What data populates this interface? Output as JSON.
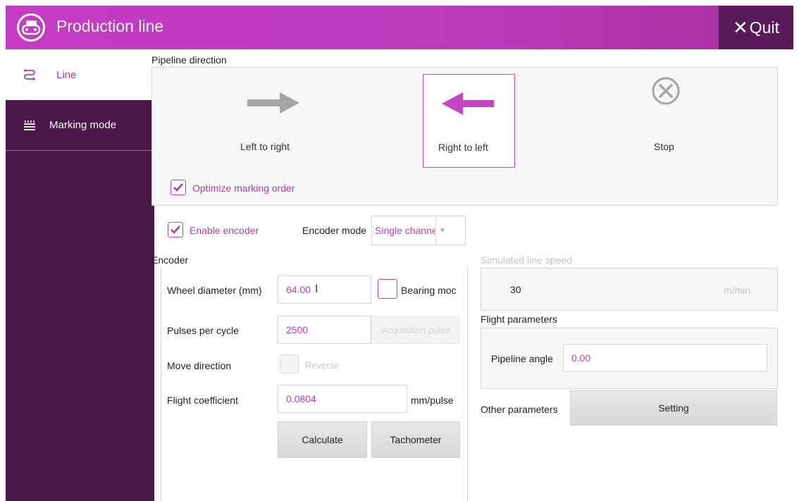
{
  "header": {
    "title": "Production line",
    "quit_label": "Quit",
    "logo_icon": "conveyor-icon",
    "background": "#c03ac0",
    "quit_background": "#5a1a5a"
  },
  "sidebar": {
    "background": "#4a1749",
    "items": [
      {
        "label": "Line",
        "icon": "route-icon",
        "selected": true
      },
      {
        "label": "Marking mode",
        "icon": "marking-lines-icon",
        "selected": false
      }
    ]
  },
  "pipeline_direction": {
    "label": "Pipeline direction",
    "options": [
      {
        "label": "Left to right",
        "icon": "arrow-right-icon",
        "selected": false
      },
      {
        "label": "Right to left",
        "icon": "arrow-left-icon",
        "selected": true
      },
      {
        "label": "Stop",
        "icon": "stop-circle-icon",
        "selected": false
      }
    ],
    "optimize_label": "Optimize marking order",
    "optimize_checked": true
  },
  "encoder_settings": {
    "enable_label": "Enable encoder",
    "enable_checked": true,
    "mode_label": "Encoder mode",
    "mode_value": "Single channel"
  },
  "encoder": {
    "label": "Encoder",
    "wheel_diameter_label": "Wheel diameter (mm)",
    "wheel_diameter_value": "64.00",
    "bearing_label": "Bearing moc",
    "bearing_checked": false,
    "pulses_label": "Pulses per cycle",
    "pulses_value": "2500",
    "acquisition_label": "Acquisition pulse",
    "move_direction_label": "Move direction",
    "reverse_label": "Reverse",
    "flight_coeff_label": "Flight coefficient",
    "flight_coeff_value": "0.0804",
    "flight_coeff_unit": "mm/pulse",
    "calculate_label": "Calculate",
    "tachometer_label": "Tachometer"
  },
  "simulated": {
    "label": "Simulated line speed",
    "value": "30",
    "unit": "m/min"
  },
  "flight": {
    "label": "Flight parameters",
    "angle_label": "Pipeline angle",
    "angle_value": "0.00"
  },
  "other": {
    "label": "Other parameters",
    "setting_label": "Setting"
  },
  "colors": {
    "accent": "#c03bc0",
    "sidebar": "#4a1749"
  }
}
